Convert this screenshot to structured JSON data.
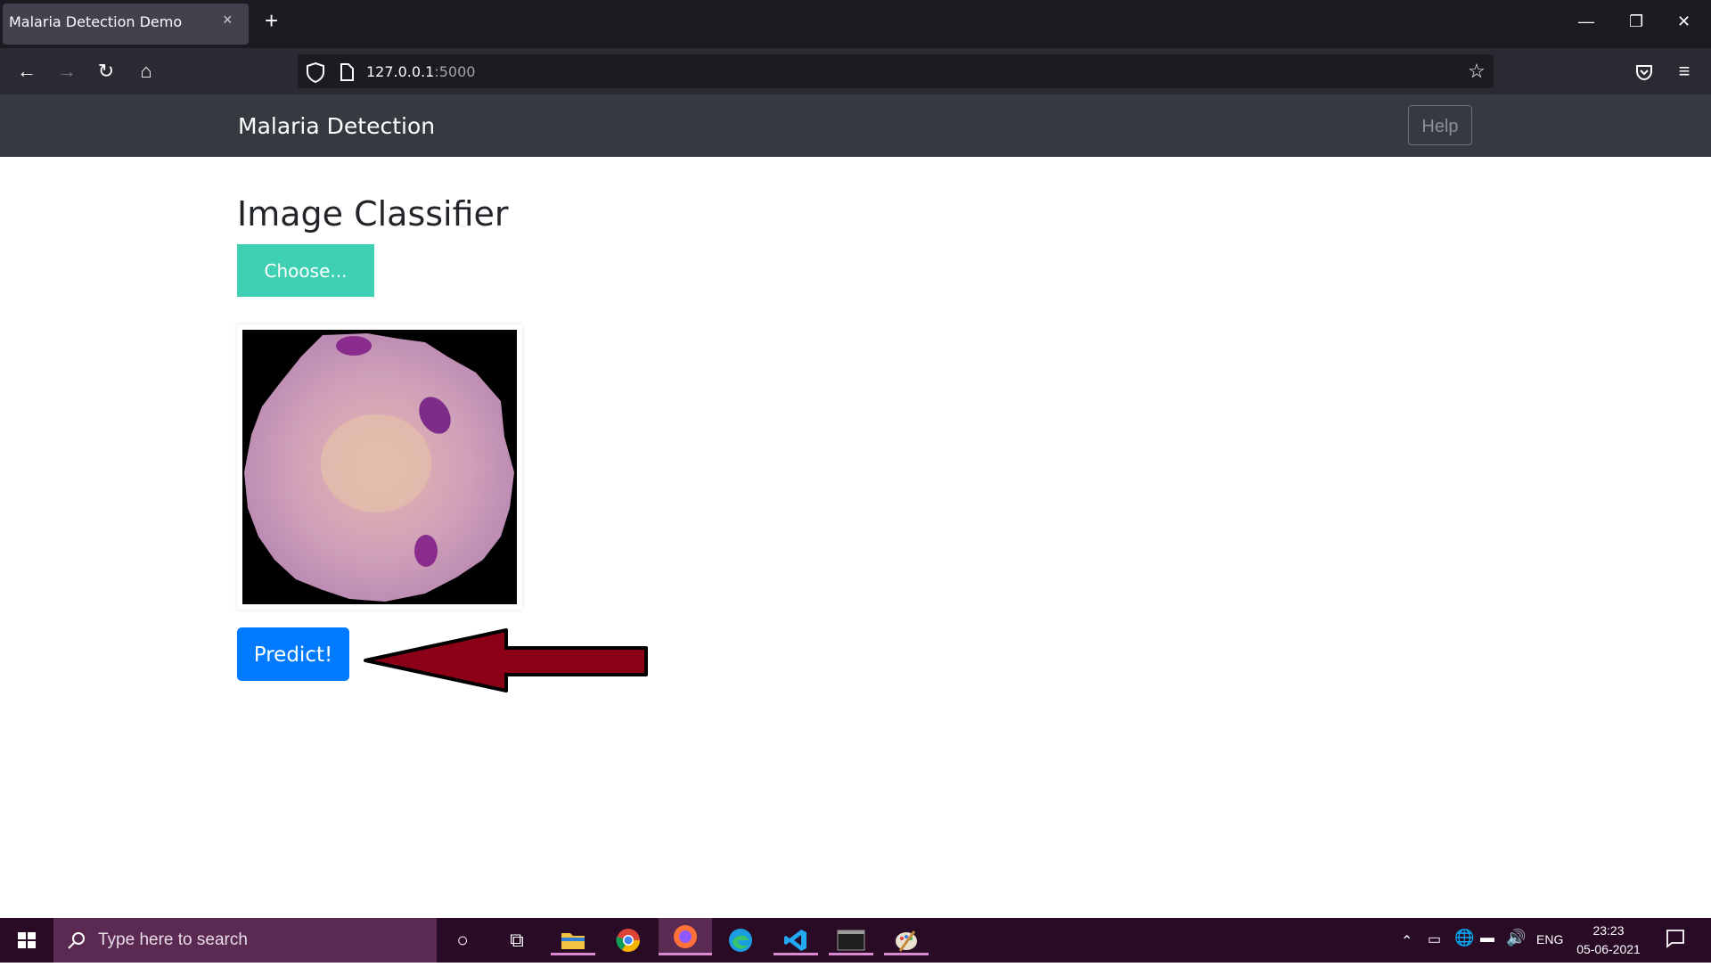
{
  "browser": {
    "tab_title": "Malaria Detection Demo",
    "tab_close": "×",
    "new_tab": "+",
    "url_host": "127.0.0.1",
    "url_port": ":5000"
  },
  "site": {
    "brand": "Malaria Detection",
    "help_label": "Help",
    "title": "Image Classifier",
    "choose_label": "Choose...",
    "predict_label": "Predict!"
  },
  "taskbar": {
    "search_placeholder": "Type here to search",
    "language": "ENG",
    "time": "23:23",
    "date": "05-06-2021"
  },
  "colors": {
    "choose_button": "#3fd0b3",
    "predict_button": "#007bff",
    "annotation_arrow": "#8b0016"
  }
}
